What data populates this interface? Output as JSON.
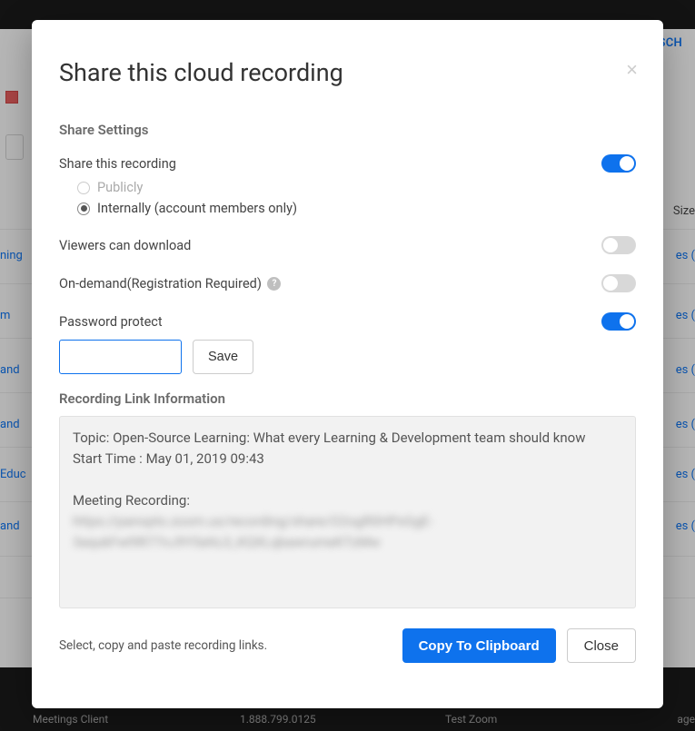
{
  "modal": {
    "title": "Share this cloud recording",
    "close_x": "×"
  },
  "share_settings": {
    "heading": "Share Settings",
    "share_recording": {
      "label": "Share this recording",
      "enabled": true
    },
    "visibility": {
      "publicly": "Publicly",
      "internally": "Internally (account members only)",
      "selected": "internally"
    },
    "viewers_can_download": {
      "label": "Viewers can download",
      "enabled": false
    },
    "on_demand": {
      "label": "On-demand(Registration Required)",
      "enabled": false,
      "help": "?"
    },
    "password_protect": {
      "label": "Password protect",
      "enabled": true
    },
    "password_value": "",
    "save_label": "Save"
  },
  "link_info": {
    "heading": "Recording Link Information",
    "topic_label": "Topic:",
    "topic_value": "Open-Source Learning: What every Learning & Development team should know",
    "start_time_label": "Start Time :",
    "start_time_value": "May 01, 2019 09:43",
    "meeting_recording_label": "Meeting Recording:",
    "url_obscured_1": "https://panopto.zoom.us/recording/share/O2ogR0HPsGgE-",
    "url_obscured_2": "3aqukFwl9R77nJ9YSehL0_KQXLqbawrumeKTzMw"
  },
  "footer": {
    "hint": "Select, copy and paste recording links.",
    "copy_label": "Copy To Clipboard",
    "close_label": "Close"
  },
  "background": {
    "sch": "SCH",
    "size": "Size",
    "age": "age",
    "left_items": [
      "ning",
      "m",
      "and",
      "and",
      "Educ",
      "and"
    ],
    "right_items": [
      "es (",
      "es (",
      "es (",
      "es (",
      "es (",
      "es ("
    ],
    "footer_items": [
      "Meetings Client",
      "1.888.799.0125",
      "Test Zoom"
    ]
  }
}
